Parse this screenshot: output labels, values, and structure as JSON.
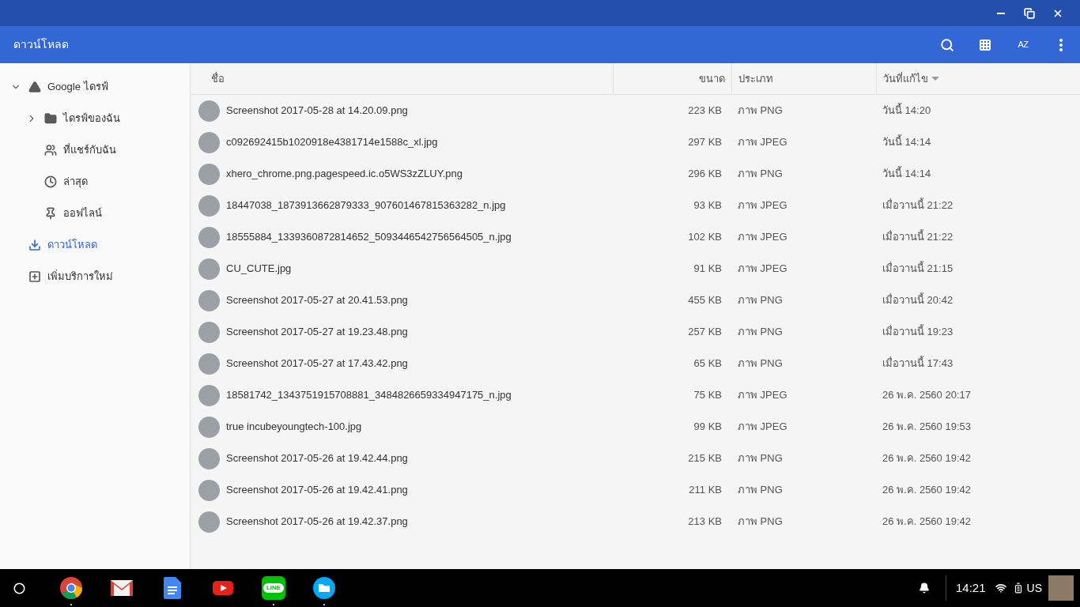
{
  "window": {
    "title": "ดาวน์โหลด",
    "controls": [
      {
        "kind": "minimize"
      },
      {
        "kind": "restore"
      },
      {
        "kind": "close"
      }
    ]
  },
  "toolbar": {
    "buttons": [
      {
        "kind": "search"
      },
      {
        "kind": "grid"
      },
      {
        "kind": "sort",
        "label": "AZ"
      },
      {
        "kind": "more"
      }
    ]
  },
  "sidebar": {
    "items": [
      {
        "label": "Google ไดรฟ์",
        "kind": "drive",
        "expanded": true,
        "selected": false,
        "children": [
          {
            "label": "ไดรฟ์ของฉัน",
            "kind": "folder",
            "expanded": false,
            "selected": false
          },
          {
            "label": "ที่แชร์กับฉัน",
            "kind": "people",
            "selected": false
          },
          {
            "label": "ล่าสุด",
            "kind": "clock",
            "selected": false
          },
          {
            "label": "ออฟไลน์",
            "kind": "pin",
            "selected": false
          }
        ]
      },
      {
        "label": "ดาวน์โหลด",
        "kind": "download",
        "selected": true
      },
      {
        "label": "เพิ่มบริการใหม่",
        "kind": "add",
        "selected": false
      }
    ]
  },
  "table": {
    "columns": [
      {
        "label": "ชื่อ",
        "sorted": false
      },
      {
        "label": "ขนาด",
        "sorted": false
      },
      {
        "label": "ประเภท",
        "sorted": false
      },
      {
        "label": "วันที่แก้ไข",
        "sorted": true
      }
    ],
    "rows": [
      {
        "name": "Screenshot 2017-05-28 at 14.20.09.png",
        "size": "223 KB",
        "type": "ภาพ PNG",
        "modified": "วันนี้ 14:20"
      },
      {
        "name": "c092692415b1020918e4381714e1588c_xl.jpg",
        "size": "297 KB",
        "type": "ภาพ JPEG",
        "modified": "วันนี้ 14:14"
      },
      {
        "name": "xhero_chrome.png.pagespeed.ic.o5WS3zZLUY.png",
        "size": "296 KB",
        "type": "ภาพ PNG",
        "modified": "วันนี้ 14:14"
      },
      {
        "name": "18447038_1873913662879333_907601467815363282_n.jpg",
        "size": "93 KB",
        "type": "ภาพ JPEG",
        "modified": "เมื่อวานนี้ 21:22"
      },
      {
        "name": "18555884_1339360872814652_5093446542756564505_n.jpg",
        "size": "102 KB",
        "type": "ภาพ JPEG",
        "modified": "เมื่อวานนี้ 21:22"
      },
      {
        "name": "CU_CUTE.jpg",
        "size": "91 KB",
        "type": "ภาพ JPEG",
        "modified": "เมื่อวานนี้ 21:15"
      },
      {
        "name": "Screenshot 2017-05-27 at 20.41.53.png",
        "size": "455 KB",
        "type": "ภาพ PNG",
        "modified": "เมื่อวานนี้ 20:42"
      },
      {
        "name": "Screenshot 2017-05-27 at 19.23.48.png",
        "size": "257 KB",
        "type": "ภาพ PNG",
        "modified": "เมื่อวานนี้ 19:23"
      },
      {
        "name": "Screenshot 2017-05-27 at 17.43.42.png",
        "size": "65 KB",
        "type": "ภาพ PNG",
        "modified": "เมื่อวานนี้ 17:43"
      },
      {
        "name": "18581742_1343751915708881_3484826659334947175_n.jpg",
        "size": "75 KB",
        "type": "ภาพ JPEG",
        "modified": "26 พ.ค. 2560 20:17"
      },
      {
        "name": "true incubeyoungtech-100.jpg",
        "size": "99 KB",
        "type": "ภาพ JPEG",
        "modified": "26 พ.ค. 2560 19:53"
      },
      {
        "name": "Screenshot 2017-05-26 at 19.42.44.png",
        "size": "215 KB",
        "type": "ภาพ PNG",
        "modified": "26 พ.ค. 2560 19:42"
      },
      {
        "name": "Screenshot 2017-05-26 at 19.42.41.png",
        "size": "211 KB",
        "type": "ภาพ PNG",
        "modified": "26 พ.ค. 2560 19:42"
      },
      {
        "name": "Screenshot 2017-05-26 at 19.42.37.png",
        "size": "213 KB",
        "type": "ภาพ PNG",
        "modified": "26 พ.ค. 2560 19:42"
      }
    ]
  },
  "shelf": {
    "apps": [
      {
        "kind": "chrome",
        "running": true
      },
      {
        "kind": "gmail",
        "running": false
      },
      {
        "kind": "docs",
        "running": false
      },
      {
        "kind": "youtube",
        "running": false
      },
      {
        "kind": "line",
        "label": "LINE",
        "running": true
      },
      {
        "kind": "files",
        "running": true
      }
    ],
    "tray": {
      "time": "14:21",
      "keyboard": "US"
    }
  }
}
